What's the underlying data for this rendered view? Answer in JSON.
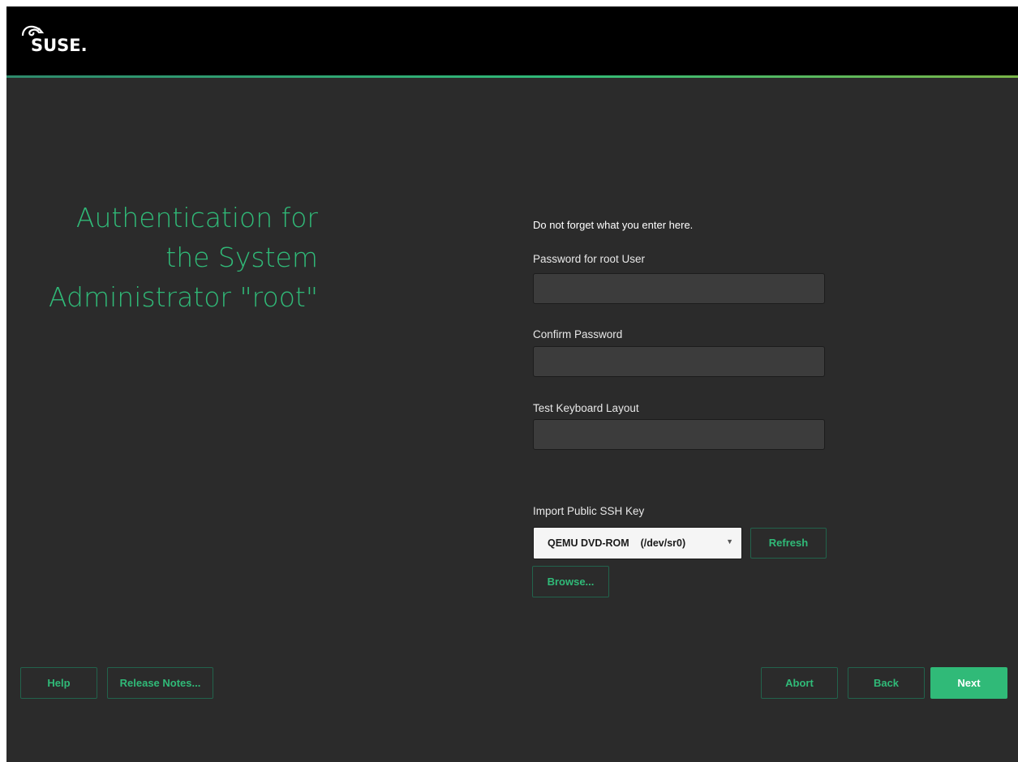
{
  "header": {
    "logo_text": "SUSE."
  },
  "heading": {
    "line1": "Authentication for",
    "line2": "the System",
    "line3": "Administrator \"root\""
  },
  "form": {
    "note": "Do not forget what you enter here.",
    "password_label": "Password for root User",
    "password_value": "",
    "confirm_label": "Confirm Password",
    "confirm_value": "",
    "keyboard_label": "Test Keyboard Layout",
    "keyboard_value": "",
    "ssh_label": "Import Public SSH Key",
    "ssh_device": "QEMU DVD-ROM    (/dev/sr0)",
    "refresh_label": "Refresh",
    "browse_label": "Browse..."
  },
  "footer": {
    "help_label": "Help",
    "release_notes_label": "Release Notes...",
    "abort_label": "Abort",
    "back_label": "Back",
    "next_label": "Next"
  },
  "colors": {
    "accent": "#30ba78",
    "background": "#2b2b2b",
    "topbar": "#000000"
  },
  "icons": {
    "logo": "suse-chameleon-icon",
    "dropdown": "chevron-down-icon"
  }
}
